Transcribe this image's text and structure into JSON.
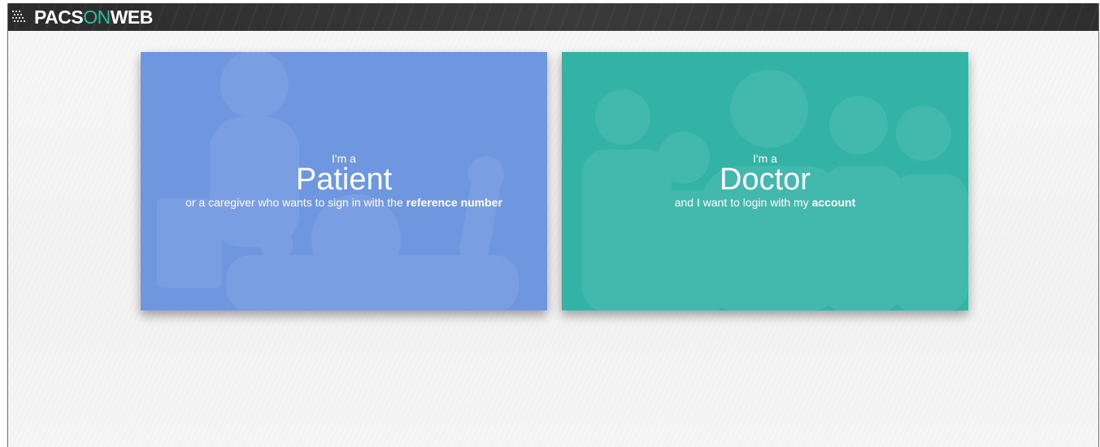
{
  "header": {
    "logo_main": "PACS",
    "logo_on": "ON",
    "logo_end": "WEB"
  },
  "cards": {
    "patient": {
      "pre": "I'm a",
      "title": "Patient",
      "sub_text": "or a caregiver who wants to sign in with the ",
      "sub_bold": "reference number",
      "color": "#6f97e0"
    },
    "doctor": {
      "pre": "I'm a",
      "title": "Doctor",
      "sub_text": "and I want to login with my ",
      "sub_bold": "account",
      "color": "#33b3a6"
    }
  },
  "colors": {
    "header_bg": "#333333",
    "accent": "#24c1a6",
    "frame_border": "#2a7fb0"
  }
}
